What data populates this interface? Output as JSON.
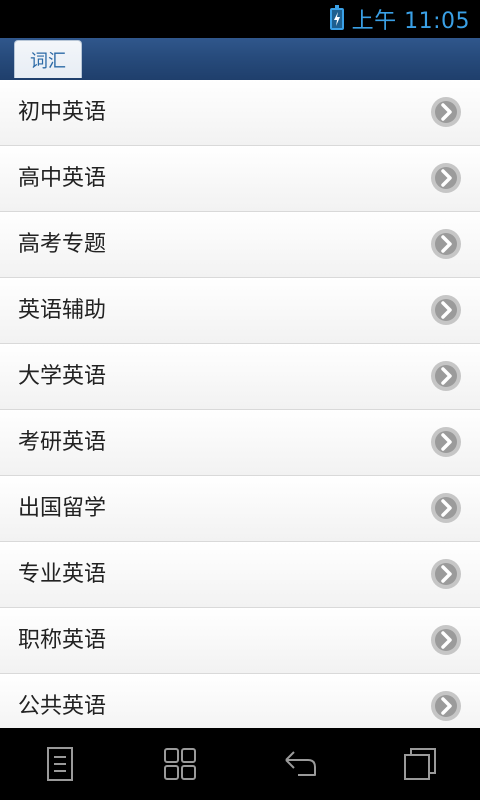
{
  "status_bar": {
    "time": "上午 11:05",
    "battery_icon": "battery-charging-icon",
    "accent": "#3aa0e6"
  },
  "tabs": [
    {
      "label": "词汇",
      "selected": true
    }
  ],
  "list": {
    "items": [
      {
        "label": "初中英语"
      },
      {
        "label": "高中英语"
      },
      {
        "label": "高考专题"
      },
      {
        "label": "英语辅助"
      },
      {
        "label": "大学英语"
      },
      {
        "label": "考研英语"
      },
      {
        "label": "出国留学"
      },
      {
        "label": "专业英语"
      },
      {
        "label": "职称英语"
      },
      {
        "label": "公共英语"
      }
    ],
    "chevron_icon": "chevron-right-circle-icon"
  },
  "nav_bar": {
    "buttons": [
      {
        "icon": "menu-icon"
      },
      {
        "icon": "home-grid-icon"
      },
      {
        "icon": "back-icon"
      },
      {
        "icon": "recent-apps-icon"
      }
    ]
  }
}
